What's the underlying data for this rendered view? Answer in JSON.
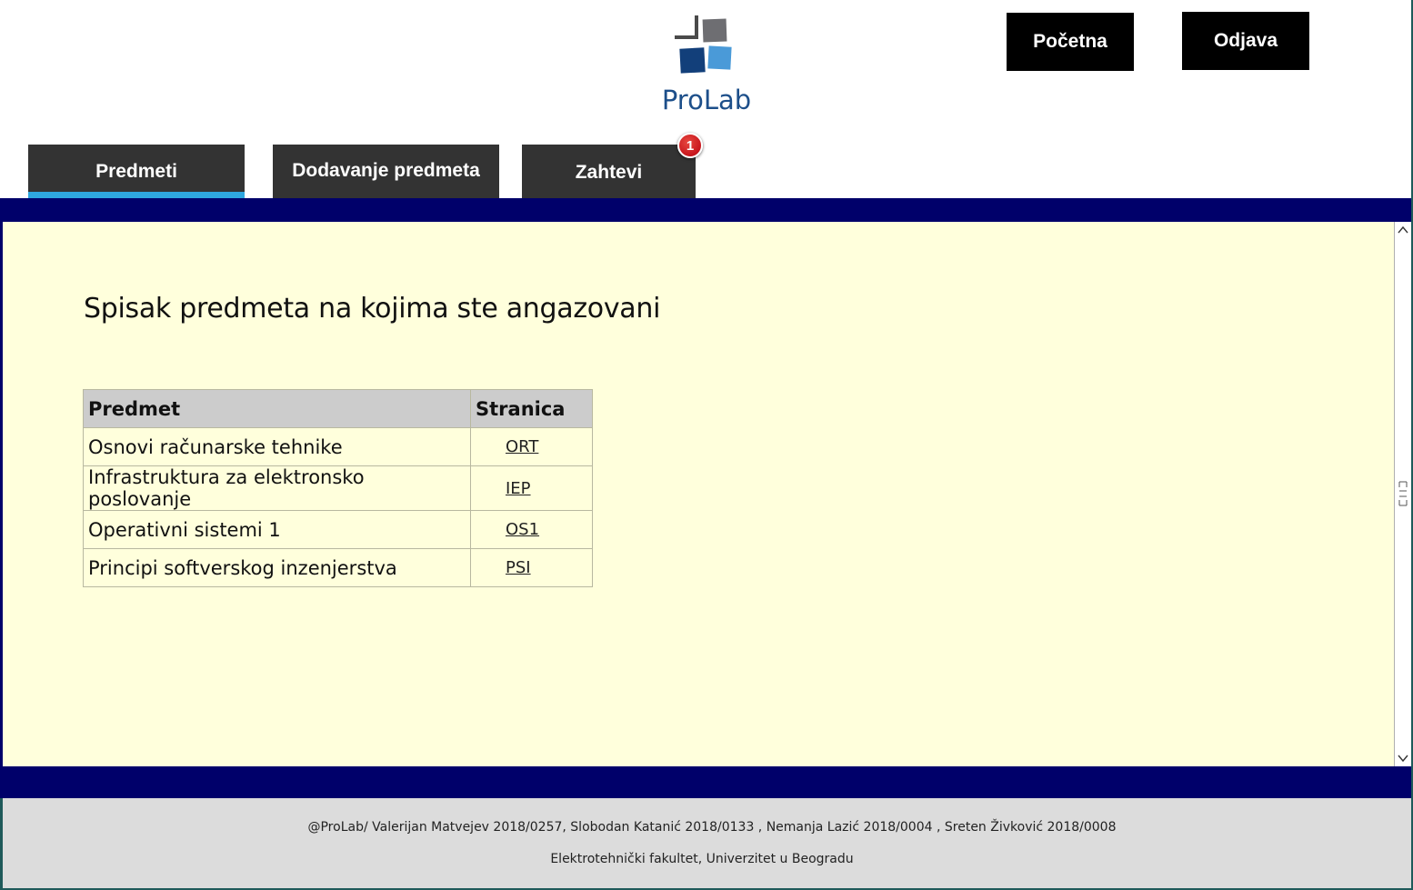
{
  "header": {
    "logo_text": "ProLab",
    "home_button": "Početna",
    "logout_button": "Odjava"
  },
  "tabs": [
    {
      "label": "Predmeti",
      "active": true
    },
    {
      "label": "Dodavanje predmeta",
      "active": false
    },
    {
      "label": "Zahtevi",
      "active": false,
      "badge": "1"
    }
  ],
  "main": {
    "title": "Spisak predmeta na kojima ste angazovani",
    "table": {
      "headers": [
        "Predmet",
        "Stranica"
      ],
      "rows": [
        {
          "subject": "Osnovi računarske tehnike",
          "page": "ORT"
        },
        {
          "subject": "Infrastruktura za elektronsko poslovanje",
          "page": "IEP"
        },
        {
          "subject": "Operativni sistemi 1",
          "page": "OS1"
        },
        {
          "subject": "Principi softverskog inzenjerstva",
          "page": "PSI"
        }
      ]
    }
  },
  "footer": {
    "line1": "@ProLab/ Valerijan Matvejev 2018/0257, Slobodan Katanić 2018/0133 , Nemanja Lazić 2018/0004 , Sreten Živković 2018/0008",
    "line2": "Elektrotehnički fakultet, Univerzitet u Beogradu"
  },
  "colors": {
    "navy": "#00006a",
    "content_bg": "#ffffdc",
    "tab_bg": "#333333",
    "tab_active_underline": "#2fa7df",
    "badge": "#c8161d",
    "logo_text": "#1d4f8a"
  }
}
